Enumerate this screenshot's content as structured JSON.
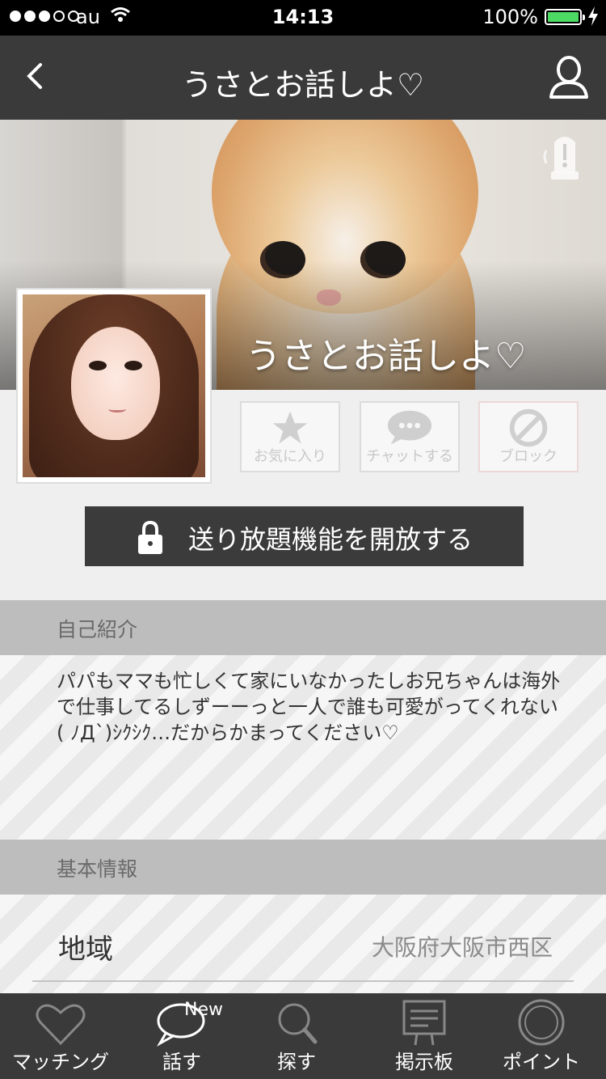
{
  "status_bar": {
    "carrier": "au",
    "time": "14:13",
    "battery": "100%"
  },
  "nav": {
    "title": "うさとお話しよ♡",
    "back_icon": "chevron-left-icon",
    "profile_icon": "user-icon"
  },
  "profile": {
    "name": "うさとお話しよ♡",
    "report_icon": "alert-icon"
  },
  "actions": {
    "favorite_label": "お気に入り",
    "chat_label": "チャットする",
    "block_label": "ブロック"
  },
  "unlock": {
    "label": "送り放題機能を開放する"
  },
  "intro": {
    "header": "自己紹介",
    "text": "パパもママも忙しくて家にいなかったしお兄ちゃんは海外で仕事してるしずーーっと一人で誰も可愛がってくれない( ﾉД`)ｼｸｼｸ…だからかまってください♡"
  },
  "basic_info": {
    "header": "基本情報",
    "rows": [
      {
        "label": "地域",
        "value": "大阪府大阪市西区"
      }
    ]
  },
  "tabs": [
    {
      "label": "マッチング",
      "icon": "heart-icon"
    },
    {
      "label": "話す",
      "icon": "speech-bubble-icon",
      "badge": "New"
    },
    {
      "label": "探す",
      "icon": "search-icon"
    },
    {
      "label": "掲示板",
      "icon": "board-icon"
    },
    {
      "label": "ポイント",
      "icon": "coin-icon"
    }
  ],
  "colors": {
    "bar": "#3a3a3a",
    "section_header": "#bdbdbd",
    "battery": "#4cd964"
  }
}
